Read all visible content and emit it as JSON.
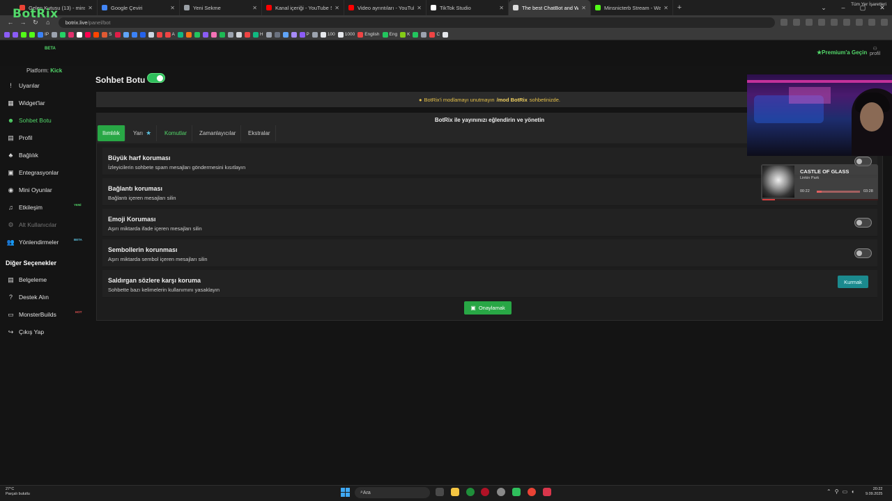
{
  "browser": {
    "tabs": [
      {
        "title": "Gelen Kutusu (13) - minsnicterb",
        "color": "#ea4335",
        "active": false
      },
      {
        "title": "Google Çeviri",
        "color": "#4285f4",
        "active": false
      },
      {
        "title": "Yeni Sekme",
        "color": "#9aa0a6",
        "active": false
      },
      {
        "title": "Kanal içeriği - YouTube Studio",
        "color": "#ff0000",
        "active": false
      },
      {
        "title": "Video ayrıntıları - YouTube Stu",
        "color": "#ff0000",
        "active": false
      },
      {
        "title": "TikTok Studio",
        "color": "#ffffff",
        "active": false
      },
      {
        "title": "The best ChatBot and Widgets",
        "color": "#dddddd",
        "active": true
      },
      {
        "title": "Minsnicterb Stream - Watch Li",
        "color": "#53fc18",
        "active": false
      }
    ],
    "new_tab": "+",
    "url_host": "botrix.live",
    "url_path": "/panel/bot",
    "bookmarks": [
      {
        "label": "",
        "color": "#8b5cf6"
      },
      {
        "label": "",
        "color": "#8b5cf6"
      },
      {
        "label": "",
        "color": "#53fc18"
      },
      {
        "label": "",
        "color": "#53fc18"
      },
      {
        "label": "IP",
        "color": "#3b82f6"
      },
      {
        "label": "",
        "color": "#9ca3af"
      },
      {
        "label": "",
        "color": "#25d366"
      },
      {
        "label": "",
        "color": "#e1306c"
      },
      {
        "label": "",
        "color": "#ffffff"
      },
      {
        "label": "",
        "color": "#ff0050"
      },
      {
        "label": "",
        "color": "#ff4500"
      },
      {
        "label": "S",
        "color": "#e05a33"
      },
      {
        "label": "",
        "color": "#e11d48"
      },
      {
        "label": "",
        "color": "#60a5fa"
      },
      {
        "label": "",
        "color": "#3b82f6"
      },
      {
        "label": "",
        "color": "#2563eb"
      },
      {
        "label": "",
        "color": "#cbd5e1"
      },
      {
        "label": "",
        "color": "#ef4444"
      },
      {
        "label": "A",
        "color": "#ef4444"
      },
      {
        "label": "",
        "color": "#10b981"
      },
      {
        "label": "",
        "color": "#f97316"
      },
      {
        "label": "",
        "color": "#22c55e"
      },
      {
        "label": "",
        "color": "#8b5cf6"
      },
      {
        "label": "",
        "color": "#f472b6"
      },
      {
        "label": "",
        "color": "#1db954"
      },
      {
        "label": "",
        "color": "#9ca3af"
      },
      {
        "label": "",
        "color": "#d1d5db"
      },
      {
        "label": "",
        "color": "#ef4444"
      },
      {
        "label": "H",
        "color": "#10b981"
      },
      {
        "label": "",
        "color": "#9ca3af"
      },
      {
        "label": "",
        "color": "#6b7280"
      },
      {
        "label": "",
        "color": "#60a5fa"
      },
      {
        "label": "",
        "color": "#a78bfa"
      },
      {
        "label": "P",
        "color": "#8b5cf6"
      },
      {
        "label": "",
        "color": "#9ca3af"
      },
      {
        "label": "100",
        "color": "#e5e7eb"
      },
      {
        "label": "1000",
        "color": "#e5e7eb"
      },
      {
        "label": "English",
        "color": "#ef4444"
      },
      {
        "label": "Eng",
        "color": "#22c55e"
      },
      {
        "label": "K",
        "color": "#84cc16"
      },
      {
        "label": "",
        "color": "#22c55e"
      },
      {
        "label": "",
        "color": "#9ca3af"
      },
      {
        "label": "C",
        "color": "#ef4444"
      },
      {
        "label": "",
        "color": "#e5e7eb"
      }
    ],
    "all_bookmarks": "Tüm Yer İşaretleri"
  },
  "app": {
    "logo": "BotRix",
    "beta": "BETA",
    "premium": "Premium'a Geçin",
    "profile": "profil",
    "platform_label": "Platform:",
    "platform_value": "Kick"
  },
  "sidebar": {
    "items": [
      {
        "label": "Uyarılar",
        "icon": "!"
      },
      {
        "label": "Widget'lar",
        "icon": "▦"
      },
      {
        "label": "Sohbet Botu",
        "icon": "☻"
      },
      {
        "label": "Profil",
        "icon": "▤"
      },
      {
        "label": "Bağlılık",
        "icon": "♣"
      },
      {
        "label": "Entegrasyonlar",
        "icon": "▣"
      },
      {
        "label": "Mini Oyunlar",
        "icon": "◉"
      },
      {
        "label": "Etkileşim",
        "icon": "♫"
      },
      {
        "label": "Alt Kullanıcılar",
        "icon": "⚙"
      },
      {
        "label": "Yönlendirmeler",
        "icon": "👥"
      }
    ],
    "badge_new": "YENİ",
    "badge_beta": "BETA",
    "other_heading": "Diğer Seçenekler",
    "other_items": [
      {
        "label": "Belgeleme",
        "icon": "▤"
      },
      {
        "label": "Destek Alın",
        "icon": "?"
      },
      {
        "label": "MonsterBuilds",
        "icon": "▭"
      },
      {
        "label": "Çıkış Yap",
        "icon": "↪"
      }
    ],
    "badge_hot": "HOT"
  },
  "main": {
    "title": "Sohbet Botu",
    "notice_prefix": "BotRix'i modlamayı unutmayın",
    "notice_command": "/mod BotRix",
    "notice_suffix": "sohbetinizde.",
    "panel_title": "BotRix ile yayınınızı eğlendirin ve yönetin",
    "tabs": [
      "Ilımlılık",
      "Yarı",
      "Komutlar",
      "Zamanlayıcılar",
      "Ekstralar"
    ],
    "settings": [
      {
        "title": "Büyük harf koruması",
        "desc": "İzleyicilerin sohbete spam mesajları göndermesini kısıtlayın",
        "control": "toggle"
      },
      {
        "title": "Bağlantı koruması",
        "desc": "Bağlantı içeren mesajları silin",
        "control": "none"
      },
      {
        "title": "Emoji Koruması",
        "desc": "Aşırı miktarda ifade içeren mesajları silin",
        "control": "toggle"
      },
      {
        "title": "Sembollerin korunması",
        "desc": "Aşırı miktarda sembol içeren mesajları silin",
        "control": "toggle"
      },
      {
        "title": "Saldırgan sözlere karşı koruma",
        "desc": "Sohbette bazı kelimelerin kullanımını yasaklayın",
        "control": "button"
      }
    ],
    "setup_button": "Kurmak",
    "save_button": "Onaylamak"
  },
  "now_playing": {
    "title": "CASTLE OF GLASS",
    "artist": "Linkin Park",
    "elapsed": "00:22",
    "total": "03:28",
    "progress": 0.106
  },
  "taskbar": {
    "temperature": "27°C",
    "weather": "Parçalı bulutlu",
    "search_placeholder": "Ara",
    "time": "20:22",
    "date": "9.09.2025"
  },
  "colors": {
    "accent": "#28a745",
    "logo": "#53d86a",
    "notice": "#e6c14a",
    "setup_button": "#1b8a8e"
  }
}
